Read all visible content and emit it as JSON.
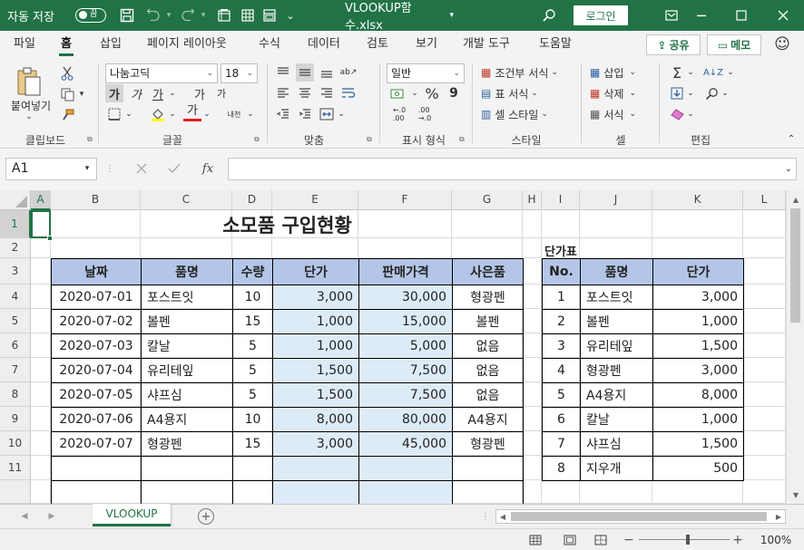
{
  "titlebar": {
    "autosave_label": "자동 저장",
    "autosave_state": "끔",
    "filename": "VLOOKUP함수.xlsx",
    "login_label": "로그인"
  },
  "menu": {
    "tabs": [
      "파일",
      "홈",
      "삽입",
      "페이지 레이아웃",
      "수식",
      "데이터",
      "검토",
      "보기",
      "개발 도구",
      "도움말"
    ],
    "share_label": "공유",
    "comment_label": "메모"
  },
  "ribbon": {
    "paste_label": "붙여넣기",
    "font_name": "나눔고딕",
    "font_size": "18",
    "bold_glyph": "가",
    "italic_glyph": "가",
    "underline_glyph": "가",
    "grow_glyph": "가",
    "shrink_glyph": "가",
    "font_color_glyph": "가",
    "phonetic_glyph": "내천",
    "number_format": "일반",
    "percent_glyph": "%",
    "comma_glyph": "9",
    "conditional_format": "조건부 서식",
    "table_format": "표 서식",
    "cell_style": "셀 스타일",
    "insert": "삽입",
    "delete": "삭제",
    "format": "서식",
    "groups": [
      "클립보드",
      "글꼴",
      "맞춤",
      "표시 형식",
      "스타일",
      "셀",
      "편집"
    ]
  },
  "formula_bar": {
    "name_box": "A1",
    "fx": "fx",
    "formula": ""
  },
  "sheet": {
    "columns": [
      "A",
      "B",
      "C",
      "D",
      "E",
      "F",
      "G",
      "H",
      "I",
      "J",
      "K",
      "L"
    ],
    "rows": [
      "1",
      "2",
      "3",
      "4",
      "5",
      "6",
      "7",
      "8",
      "9",
      "10",
      "11"
    ],
    "title": "소모품 구입현황",
    "main_headers": [
      "날짜",
      "품명",
      "수량",
      "단가",
      "판매가격",
      "사은품"
    ],
    "main_rows": [
      [
        "2020-07-01",
        "포스트잇",
        "10",
        "3,000",
        "30,000",
        "형광펜"
      ],
      [
        "2020-07-02",
        "볼펜",
        "15",
        "1,000",
        "15,000",
        "볼펜"
      ],
      [
        "2020-07-03",
        "칼날",
        "5",
        "1,000",
        "5,000",
        "없음"
      ],
      [
        "2020-07-04",
        "유리테잎",
        "5",
        "1,500",
        "7,500",
        "없음"
      ],
      [
        "2020-07-05",
        "샤프심",
        "5",
        "1,500",
        "7,500",
        "없음"
      ],
      [
        "2020-07-06",
        "A4용지",
        "10",
        "8,000",
        "80,000",
        "A4용지"
      ],
      [
        "2020-07-07",
        "형광펜",
        "15",
        "3,000",
        "45,000",
        "형광펜"
      ]
    ],
    "price_table_title": "단가표",
    "price_headers": [
      "No.",
      "품명",
      "단가"
    ],
    "price_rows": [
      [
        "1",
        "포스트잇",
        "3,000"
      ],
      [
        "2",
        "볼펜",
        "1,000"
      ],
      [
        "3",
        "유리테잎",
        "1,500"
      ],
      [
        "4",
        "형광펜",
        "3,000"
      ],
      [
        "5",
        "A4용지",
        "8,000"
      ],
      [
        "6",
        "칼날",
        "1,000"
      ],
      [
        "7",
        "샤프심",
        "1,500"
      ],
      [
        "8",
        "지우개",
        "500"
      ]
    ]
  },
  "sheet_tabs": {
    "active": "VLOOKUP"
  },
  "status": {
    "zoom": "100%"
  },
  "colors": {
    "brand": "#217346",
    "header_fill": "#b4c6e7",
    "price_fill": "#ddebf7"
  }
}
